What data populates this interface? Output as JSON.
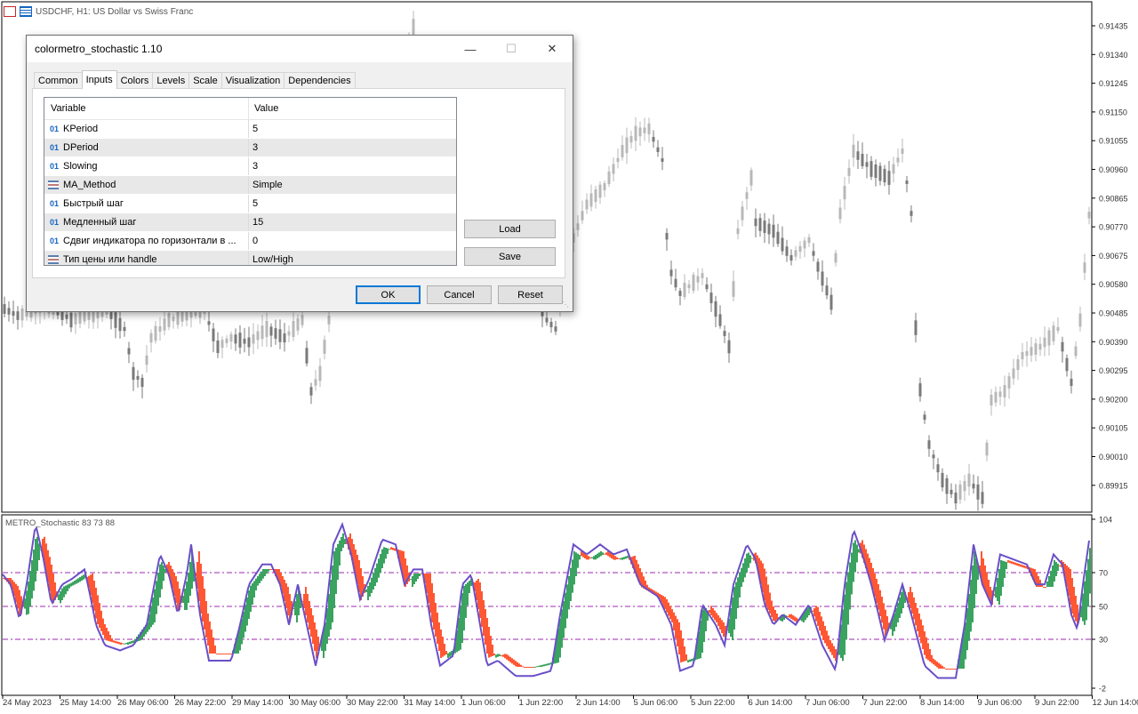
{
  "chart": {
    "symbol_title": "USDCHF, H1:  US Dollar vs Swiss Franc",
    "price_labels": [
      "0.91435",
      "0.91340",
      "0.91245",
      "0.91150",
      "0.91055",
      "0.90960",
      "0.90865",
      "0.90770",
      "0.90675",
      "0.90580",
      "0.90485",
      "0.90390",
      "0.90295",
      "0.90200",
      "0.90105",
      "0.90010",
      "0.89915"
    ],
    "indicator_label": "METRO_Stochastic 83 73 88",
    "indicator_scale": [
      "104",
      "70",
      "50",
      "30",
      "-2"
    ],
    "date_labels": [
      "24 May 2023",
      "25 May 14:00",
      "26 May 06:00",
      "26 May 22:00",
      "29 May 14:00",
      "30 May 06:00",
      "30 May 22:00",
      "31 May 14:00",
      "1 Jun 06:00",
      "1 Jun 22:00",
      "2 Jun 14:00",
      "5 Jun 06:00",
      "5 Jun 22:00",
      "6 Jun 14:00",
      "7 Jun 06:00",
      "7 Jun 22:00",
      "8 Jun 14:00",
      "9 Jun 06:00",
      "9 Jun 22:00",
      "12 Jun 14:00"
    ],
    "colors": {
      "bull": "#3aa35f",
      "bear": "#ff5733",
      "line": "#6a4fc8",
      "level": "#9c27b0",
      "candle": "#7f7f7f"
    }
  },
  "dialog": {
    "title": "colormetro_stochastic 1.10",
    "minimize_icon": "minimize-icon",
    "maximize_icon": "maximize-icon",
    "close_icon": "close-icon",
    "tabs": [
      "Common",
      "Inputs",
      "Colors",
      "Levels",
      "Scale",
      "Visualization",
      "Dependencies"
    ],
    "active_tab": "Inputs",
    "grid": {
      "header_variable": "Variable",
      "header_value": "Value",
      "rows": [
        {
          "icon": "int-icon",
          "type_badge": "01",
          "variable": "KPeriod",
          "value": "5"
        },
        {
          "icon": "int-icon",
          "type_badge": "01",
          "variable": "DPeriod",
          "value": "3"
        },
        {
          "icon": "int-icon",
          "type_badge": "01",
          "variable": "Slowing",
          "value": "3"
        },
        {
          "icon": "enum-icon",
          "type_badge": "",
          "variable": "MA_Method",
          "value": "Simple"
        },
        {
          "icon": "int-icon",
          "type_badge": "01",
          "variable": "Быстрый шаг",
          "value": "5"
        },
        {
          "icon": "int-icon",
          "type_badge": "01",
          "variable": "Медленный шаг",
          "value": "15"
        },
        {
          "icon": "int-icon",
          "type_badge": "01",
          "variable": "Сдвиг индикатора по горизонтали в ...",
          "value": "0"
        },
        {
          "icon": "enum-icon",
          "type_badge": "",
          "variable": "Тип цены или handle",
          "value": "Low/High"
        }
      ]
    },
    "buttons": {
      "load": "Load",
      "save": "Save",
      "ok": "OK",
      "cancel": "Cancel",
      "reset": "Reset"
    }
  }
}
